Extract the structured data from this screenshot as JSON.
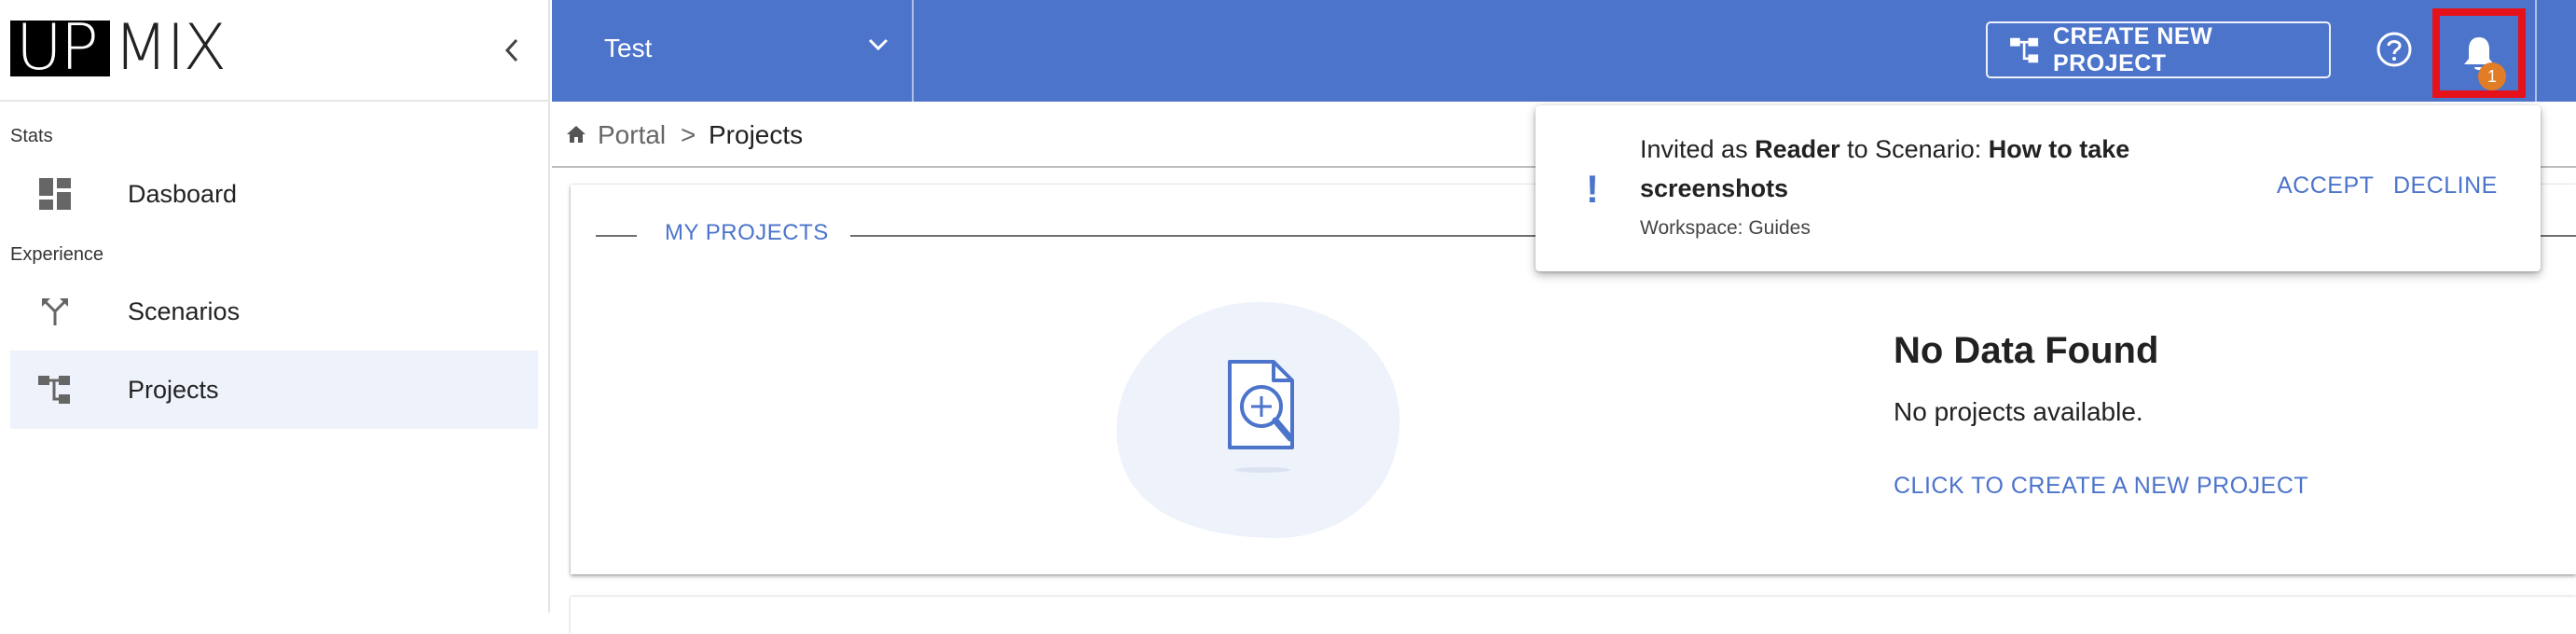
{
  "brand": {
    "logo_left": "UP",
    "logo_right": "MIX"
  },
  "sidebar": {
    "collapse_icon": "chevron-left-icon",
    "sections": [
      {
        "label": "Stats"
      },
      {
        "label": "Experience"
      }
    ],
    "items": [
      {
        "label": "Dasboard",
        "icon": "dashboard-icon",
        "active": false
      },
      {
        "label": "Scenarios",
        "icon": "scenarios-icon",
        "active": false
      },
      {
        "label": "Projects",
        "icon": "projects-icon",
        "active": true
      }
    ]
  },
  "topbar": {
    "workspace": "Test",
    "create_button_label": "CREATE NEW PROJECT",
    "help_icon": "help-icon",
    "notifications_icon": "bell-icon",
    "notification_count": "1",
    "colors": {
      "bar": "#4c74cb",
      "badge": "#e07d26",
      "highlight": "#e5121c"
    }
  },
  "breadcrumb": {
    "home_icon": "home-icon",
    "portal": "Portal",
    "separator": ">",
    "current": "Projects"
  },
  "main": {
    "section_title": "MY PROJECTS",
    "empty_state": {
      "title": "No Data Found",
      "description": "No projects available.",
      "action": "CLICK TO CREATE A NEW PROJECT",
      "icon": "search-document-icon"
    }
  },
  "notification": {
    "text_1": "Invited as ",
    "role": "Reader",
    "text_2": " to Scenario: ",
    "scenario": "How to take screenshots",
    "workspace_line": "Workspace: Guides",
    "accept_label": "ACCEPT",
    "decline_label": "DECLINE",
    "icon": "exclamation-icon"
  }
}
